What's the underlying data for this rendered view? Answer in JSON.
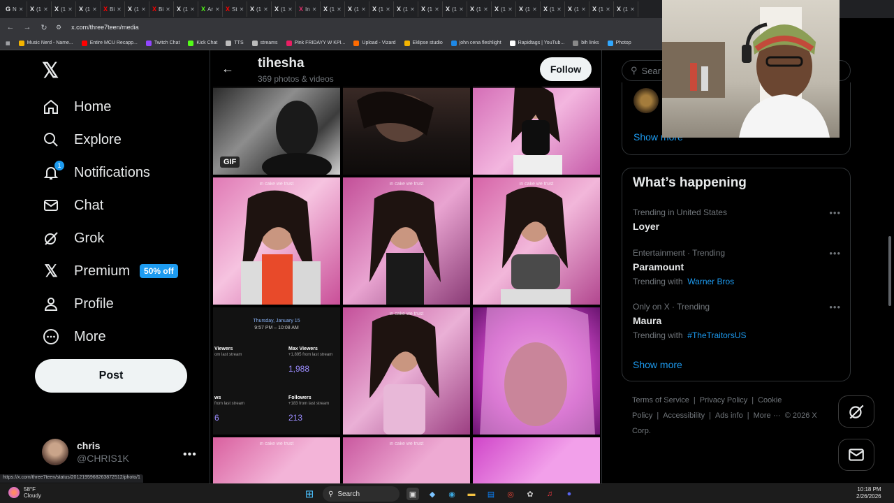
{
  "browser": {
    "tabs": [
      "N",
      "(1",
      "(1",
      "(1",
      "Bi",
      "(1",
      "Bi",
      "(1",
      "Ar",
      "St",
      "(1",
      "(1",
      "In",
      "(1",
      "(1",
      "(1",
      "(1",
      "(1",
      "(1",
      "(1",
      "(1",
      "(1",
      "(1",
      "(1",
      "(1",
      "(1"
    ],
    "url": "x.com/three7teen/media",
    "bookmarks": [
      "Music Nerd - Name...",
      "Entire MCU Recapp...",
      "Twitch Chat",
      "Kick Chat",
      "TTS",
      "streams",
      "Pink FRIDAYY W KPI...",
      "Upload - Vizard",
      "Eklipse studio",
      "john cena fleshlight",
      "Rapidtags | YouTub...",
      "bih links",
      "Photop"
    ]
  },
  "sidebar": {
    "nav": [
      {
        "label": "Home",
        "icon": "home-icon"
      },
      {
        "label": "Explore",
        "icon": "search-icon"
      },
      {
        "label": "Notifications",
        "icon": "bell-icon",
        "badge": "1"
      },
      {
        "label": "Chat",
        "icon": "mail-icon"
      },
      {
        "label": "Grok",
        "icon": "grok-icon"
      },
      {
        "label": "Premium",
        "icon": "x-icon",
        "pill": "50% off"
      },
      {
        "label": "Profile",
        "icon": "person-icon"
      },
      {
        "label": "More",
        "icon": "more-circle-icon"
      }
    ],
    "post_label": "Post",
    "account": {
      "name": "chris",
      "handle": "@CHRIS1K"
    }
  },
  "profile": {
    "name": "tihesha",
    "subtitle": "369 photos & videos",
    "follow_label": "Follow"
  },
  "media": {
    "gif_label": "GIF",
    "overlay": "in cake we trust",
    "stats": {
      "date": "Thursday, January 15",
      "time": "9:57 PM – 10:08 AM",
      "viewers_label": "Viewers",
      "viewers_delta": "om last stream",
      "max_label": "Max Viewers",
      "max_delta": "+1,895 from last stream",
      "max_value": "1,988",
      "ws_label": "ws",
      "ws_delta": "from last stream",
      "ws_value": "6",
      "followers_label": "Followers",
      "followers_delta": "+183 from last stream",
      "followers_value": "213"
    }
  },
  "right": {
    "search_placeholder": "Sear",
    "show_more": "Show more",
    "whats_happening": "What’s happening",
    "trends": [
      {
        "meta": "Trending in United States",
        "name": "Loyer",
        "with": ""
      },
      {
        "meta": "Entertainment · Trending",
        "name": "Paramount",
        "with_prefix": "Trending with",
        "with": "Warner Bros"
      },
      {
        "meta": "Only on X · Trending",
        "name": "Maura",
        "with_prefix": "Trending with",
        "with": "#TheTraitorsUS"
      }
    ],
    "show_more_2": "Show more",
    "footer": [
      "Terms of Service",
      "|",
      "Privacy Policy",
      "|",
      "Cookie Policy",
      "|",
      "Accessibility",
      "|",
      "Ads info",
      "|",
      "More ···",
      "© 2026 X Corp."
    ]
  },
  "status_url": "https://x.com/three7teen/status/2012195968263872512/photo/1",
  "taskbar": {
    "temp": "58°F",
    "condition": "Cloudy",
    "search": "Search",
    "time": "10:18 PM",
    "date": "2/26/2026"
  }
}
